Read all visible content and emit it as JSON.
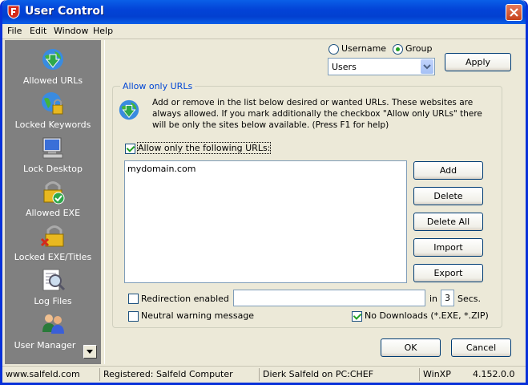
{
  "window": {
    "title": "User Control"
  },
  "menu": [
    "File",
    "Edit",
    "Window",
    "Help"
  ],
  "sidebar": {
    "items": [
      {
        "label": "Allowed URLs",
        "icon": "globe-arrow-icon"
      },
      {
        "label": "Locked Keywords",
        "icon": "globe-lock-icon"
      },
      {
        "label": "Lock Desktop",
        "icon": "computer-icon"
      },
      {
        "label": "Allowed EXE",
        "icon": "lock-check-icon"
      },
      {
        "label": "Locked EXE/Titles",
        "icon": "lock-x-icon"
      },
      {
        "label": "Log Files",
        "icon": "magnifier-doc-icon"
      },
      {
        "label": "User Manager",
        "icon": "users-icon"
      }
    ]
  },
  "target": {
    "username_label": "Username",
    "group_label": "Group",
    "selected": "Group",
    "dropdown_value": "Users",
    "apply_label": "Apply"
  },
  "group": {
    "title": "Allow only URLs",
    "description": "Add or remove in the list below desired or wanted URLs. These websites are always allowed. If you mark additionally the checkbox \"Allow only URLs\" there will be only the sites below available. (Press F1 for help)",
    "allow_only_label": "Allow only the following URLs:",
    "allow_only_checked": true,
    "urls": [
      "mydomain.com"
    ],
    "buttons": {
      "add": "Add",
      "delete": "Delete",
      "delete_all": "Delete All",
      "import": "Import",
      "export": "Export"
    },
    "redirection_label": "Redirection enabled",
    "redirection_checked": false,
    "redirection_value": "",
    "in_label": "in",
    "seconds_value": "3",
    "secs_label": "Secs.",
    "neutral_label": "Neutral warning message",
    "neutral_checked": false,
    "no_downloads_label": "No Downloads (*.EXE, *.ZIP)",
    "no_downloads_checked": true
  },
  "dialog": {
    "ok_label": "OK",
    "cancel_label": "Cancel"
  },
  "status": {
    "website": "www.salfeld.com",
    "registered": "Registered: Salfeld Computer",
    "user": "Dierk Salfeld on PC:CHEF",
    "os": "WinXP",
    "version": "4.152.0.0"
  }
}
